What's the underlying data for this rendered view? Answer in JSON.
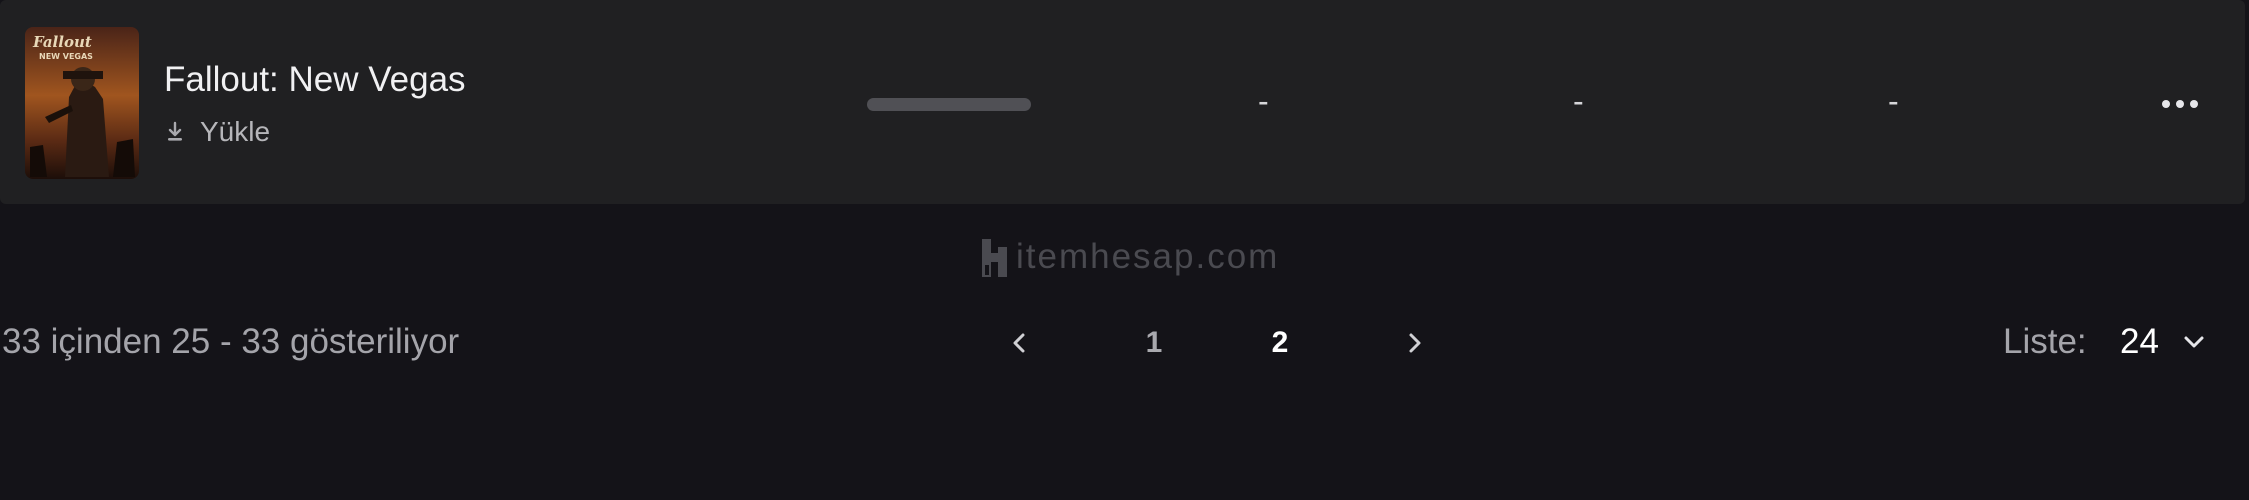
{
  "game": {
    "title": "Fallout: New Vegas",
    "install_label": "Yükle",
    "cover_art_text": "Fallout NEW VEGAS",
    "columns": [
      "-",
      "-",
      "-"
    ]
  },
  "watermark": {
    "text": "itemhesap.com"
  },
  "pagination": {
    "showing_text": "33 içinden 25 - 33 gösteriliyor",
    "pages": [
      "1",
      "2"
    ],
    "active_page": "2",
    "list_label": "Liste:",
    "list_value": "24"
  },
  "icons": {
    "install": "download-icon",
    "more": "more-options-icon",
    "prev": "chevron-left-icon",
    "next": "chevron-right-icon",
    "dropdown": "chevron-down-icon"
  },
  "colors": {
    "background": "#141318",
    "row_background": "#202022",
    "progress_track": "#505055",
    "text_primary": "#f1f1f3",
    "text_secondary": "#a4a4aa"
  }
}
